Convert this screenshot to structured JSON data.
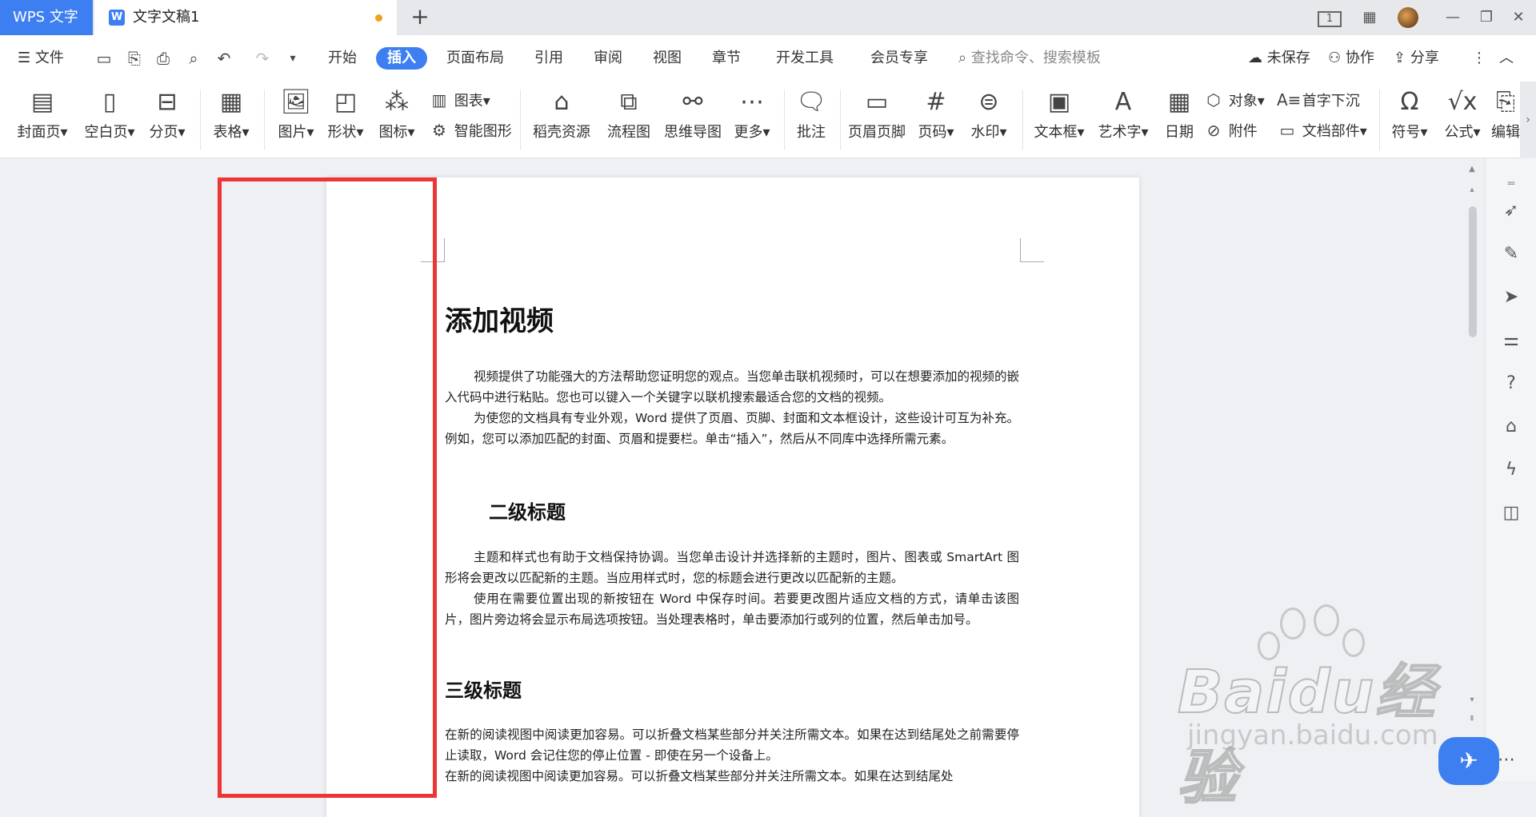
{
  "titlebar": {
    "app_tab": "WPS 文字",
    "doc_tab": "文字文稿1",
    "new_tab_glyph": "+",
    "page_indicator": "1",
    "controls": {
      "minimize": "—",
      "restore": "❐",
      "close": "✕"
    }
  },
  "menubar": {
    "file": "文件",
    "tabs": [
      "开始",
      "插入",
      "页面布局",
      "引用",
      "审阅",
      "视图",
      "章节",
      "开发工具",
      "会员专享"
    ],
    "active_tab": "插入",
    "search_placeholder": "查找命令、搜索模板",
    "unsaved": "未保存",
    "collab": "协作",
    "share": "分享"
  },
  "ribbon": {
    "cover_page": "封面页",
    "blank_page": "空白页",
    "page_break": "分页",
    "table": "表格",
    "picture": "图片",
    "shape": "形状",
    "icons": "图标",
    "chart": "图表",
    "smart_graphic": "智能图形",
    "docer_resources": "稻壳资源",
    "flowchart": "流程图",
    "mindmap": "思维导图",
    "more": "更多",
    "comment": "批注",
    "header_footer": "页眉页脚",
    "page_number": "页码",
    "watermark": "水印",
    "textbox": "文本框",
    "wordart": "艺术字",
    "date": "日期",
    "object": "对象",
    "drop_cap": "首字下沉",
    "attachment": "附件",
    "doc_parts": "文档部件",
    "symbol": "符号",
    "formula": "公式",
    "edit": "编辑"
  },
  "document": {
    "h1": "添加视频",
    "p1": "视频提供了功能强大的方法帮助您证明您的观点。当您单击联机视频时，可以在想要添加的视频的嵌入代码中进行粘贴。您也可以键入一个关键字以联机搜索最适合您的文档的视频。",
    "p2": "为使您的文档具有专业外观，Word 提供了页眉、页脚、封面和文本框设计，这些设计可互为补充。例如，您可以添加匹配的封面、页眉和提要栏。单击“插入”，然后从不同库中选择所需元素。",
    "h2": "二级标题",
    "p3": "主题和样式也有助于文档保持协调。当您单击设计并选择新的主题时，图片、图表或 SmartArt 图形将会更改以匹配新的主题。当应用样式时，您的标题会进行更改以匹配新的主题。",
    "p4": "使用在需要位置出现的新按钮在 Word 中保存时间。若要更改图片适应文档的方式，请单击该图片，图片旁边将会显示布局选项按钮。当处理表格时，单击要添加行或列的位置，然后单击加号。",
    "h3": "三级标题",
    "p5": "在新的阅读视图中阅读更加容易。可以折叠文档某些部分并关注所需文本。如果在达到结尾处之前需要停止读取，Word 会记住您的停止位置 - 即使在另一个设备上。",
    "p6": "在新的阅读视图中阅读更加容易。可以折叠文档某些部分并关注所需文本。如果在达到结尾处"
  },
  "watermark": {
    "big": "Baidu经验",
    "small": "jingyan.baidu.com"
  },
  "colors": {
    "accent": "#3d7ff0",
    "highlight_box": "#ee3535"
  }
}
